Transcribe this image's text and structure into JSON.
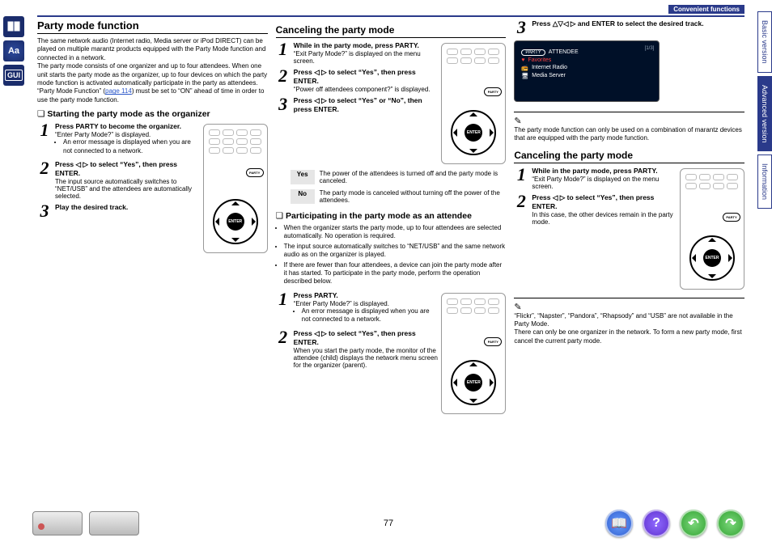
{
  "header": {
    "chip": "Convenient functions"
  },
  "tabs": {
    "basic": "Basic version",
    "advanced": "Advanced version",
    "information": "Information"
  },
  "col1": {
    "title": "Party mode function",
    "intro1": "The same network audio (Internet radio, Media server or iPod DIRECT) can be played on multiple marantz products equipped with the Party Mode function and connected in a network.",
    "intro2": "The party mode consists of one organizer and up to four attendees. When one unit starts the party mode as the organizer, up to four devices on which the party mode function is activated automatically participate in the party as attendees. “Party Mode Function” (",
    "pagelink": "page 114",
    "intro2b": ") must be set to “ON” ahead of time in order to use the party mode function.",
    "sub": "Starting the party mode as the organizer",
    "s1lead": "Press PARTY to become the organizer.",
    "s1d1": "“Enter Party Mode?” is displayed.",
    "s1d2": "An error message is displayed when you are not connected to a network.",
    "s2lead": "Press ◁ ▷ to select “Yes”, then press ENTER.",
    "s2d": "The input source automatically switches to “NET/USB” and the attendees are automatically selected.",
    "s3lead": "Play the desired track."
  },
  "col2": {
    "h2a": "Canceling the party mode",
    "a1lead": "While in the party mode, press PARTY.",
    "a1d": "“Exit Party Mode?” is displayed on the menu screen.",
    "a2lead": "Press ◁ ▷ to select “Yes”, then press ENTER.",
    "a2d": "“Power off attendees component?” is displayed.",
    "a3lead": "Press ◁ ▷ to select “Yes” or “No”, then press ENTER.",
    "yes": "Yes",
    "yesd": "The power of the attendees is turned off and the party mode is canceled.",
    "no": "No",
    "nod": "The party mode is canceled without turning off the power of the attendees.",
    "sub": "Participating in the party mode as an attendee",
    "b_bul1": "When the organizer starts the party mode, up to four attendees are selected automatically. No operation is required.",
    "b_bul2": "The input source automatically switches to “NET/USB” and the same network audio as on the organizer is played.",
    "b_bul3": "If there are fewer than four attendees, a device can join the party mode after it has started. To participate in the party mode, perform the operation described below.",
    "b1lead": "Press PARTY.",
    "b1d": "“Enter Party Mode?” is displayed.",
    "b1d2": "An error message is displayed when you are not connected to a network.",
    "b2lead": "Press ◁ ▷ to select “Yes”, then press ENTER.",
    "b2d": "When you start the party mode, the monitor of the attendee (child) displays the network menu screen for the organizer (parent)."
  },
  "col3": {
    "s3lead": "Press △▽◁ ▷ and ENTER to select the desired track.",
    "tv": {
      "tr": "[1/3]",
      "party": "PARTY",
      "att": "ATTENDEE",
      "fav": "Favorites",
      "ir": "Internet Radio",
      "ms": "Media Server"
    },
    "note1": "The party mode function can only be used on a combination of marantz devices that are equipped with the party mode function.",
    "h2b": "Canceling the party mode",
    "c1lead": "While in the party mode, press PARTY.",
    "c1d": "“Exit Party Mode?” is displayed on the menu screen.",
    "c2lead": "Press ◁ ▷ to select “Yes”, then press ENTER.",
    "c2d": "In this case, the other devices remain in the party mode.",
    "note2a": "“Flickr”, “Napster”, “Pandora”, “Rhapsody” and “USB” are not available in the Party Mode.",
    "note2b": "There can only be one organizer in the network. To form a new party mode, first cancel the current party mode."
  },
  "footer": {
    "page": "77"
  },
  "icons": {
    "gui": "GUI",
    "aa": "Aa",
    "enter": "ENTER",
    "party": "PARTY"
  }
}
